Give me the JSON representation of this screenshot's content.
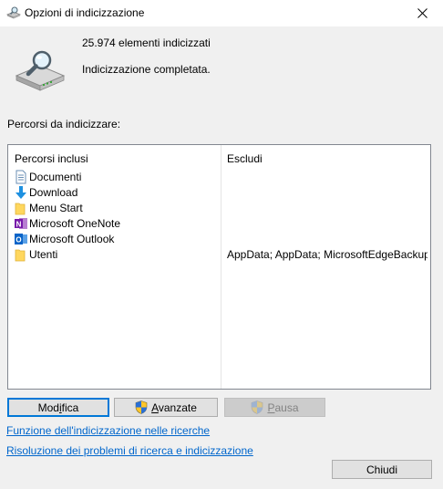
{
  "window": {
    "title": "Opzioni di indicizzazione",
    "close_glyph": "✕"
  },
  "status": {
    "count_text": "25.974 elementi indicizzati",
    "status_text": "Indicizzazione completata.",
    "icon": "drive-search-icon"
  },
  "section_label": "Percorsi da indicizzare:",
  "table": {
    "columns": [
      "Percorsi inclusi",
      "Escludi"
    ],
    "rows": [
      {
        "name": "Documenti",
        "icon": "document-library-icon",
        "exclude": ""
      },
      {
        "name": "Download",
        "icon": "download-arrow-icon",
        "exclude": ""
      },
      {
        "name": "Menu Start",
        "icon": "folder-icon",
        "exclude": ""
      },
      {
        "name": "Microsoft OneNote",
        "icon": "onenote-icon",
        "exclude": ""
      },
      {
        "name": "Microsoft Outlook",
        "icon": "outlook-icon",
        "exclude": ""
      },
      {
        "name": "Utenti",
        "icon": "folder-icon",
        "exclude": "AppData; AppData; MicrosoftEdgeBackup..."
      }
    ]
  },
  "buttons": {
    "modifica": {
      "pre": "Mod",
      "key": "i",
      "post": "fica"
    },
    "avanzate": {
      "pre": "",
      "key": "A",
      "post": "vanzate"
    },
    "pausa": {
      "pre": "",
      "key": "P",
      "post": "ausa"
    },
    "chiudi": "Chiudi"
  },
  "links": {
    "search_indexing": "Funzione dell'indicizzazione nelle ricerche",
    "troubleshoot": "Risoluzione dei problemi di ricerca e indicizzazione"
  },
  "colors": {
    "accent": "#0078d7",
    "link": "#0066cc",
    "window_bg": "#f0f0f0"
  }
}
